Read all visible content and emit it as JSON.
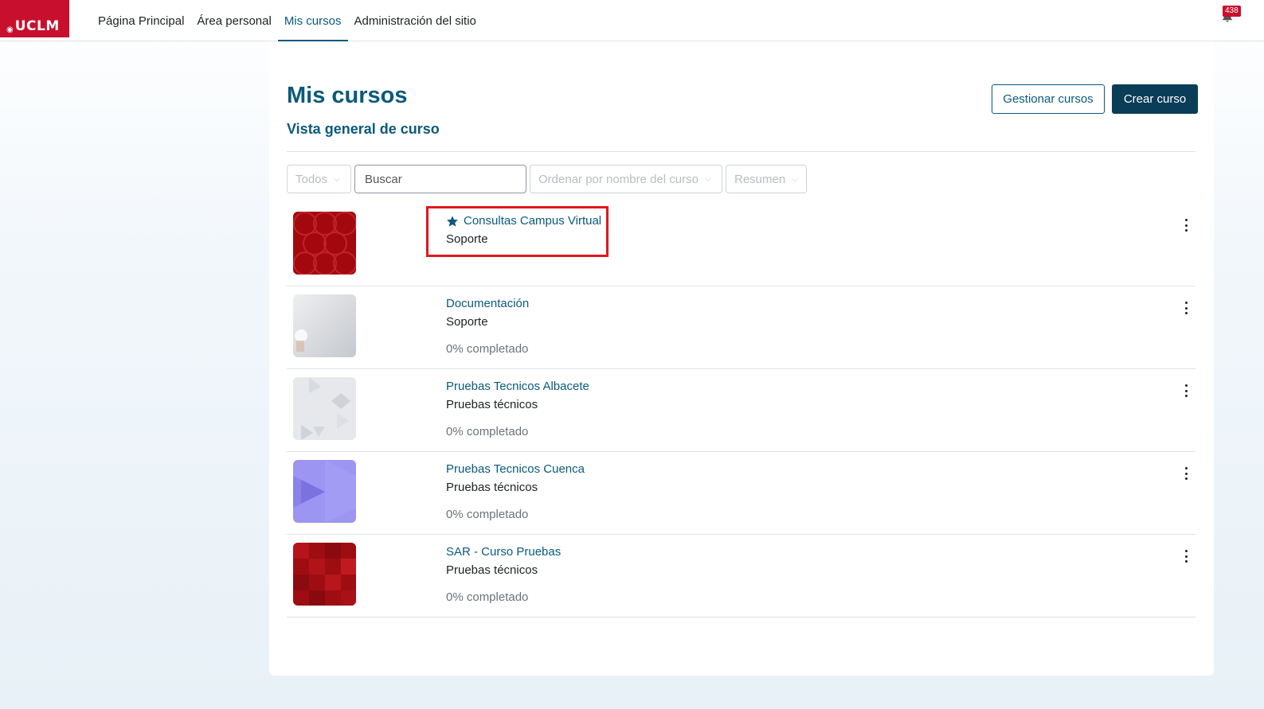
{
  "nav": {
    "logo": "UCLM",
    "items": [
      {
        "label": "Página Principal",
        "active": false
      },
      {
        "label": "Área personal",
        "active": false
      },
      {
        "label": "Mis cursos",
        "active": true
      },
      {
        "label": "Administración del sitio",
        "active": false
      }
    ],
    "notifications_count": "438"
  },
  "page": {
    "title": "Mis cursos",
    "manage_button": "Gestionar cursos",
    "create_button": "Crear curso",
    "section_title": "Vista general de curso"
  },
  "filters": {
    "grouping": "Todos",
    "search_placeholder": "Buscar",
    "sort": "Ordenar por nombre del curso",
    "view": "Resumen"
  },
  "courses": [
    {
      "name": "Consultas Campus Virtual",
      "category": "Soporte",
      "progress": "",
      "starred": true,
      "thumb": "red-circles"
    },
    {
      "name": "Documentación",
      "category": "Soporte",
      "progress": "0% completado",
      "starred": false,
      "thumb": "grey-bulb"
    },
    {
      "name": "Pruebas Tecnicos Albacete",
      "category": "Pruebas técnicos",
      "progress": "0% completado",
      "starred": false,
      "thumb": "light-triangles"
    },
    {
      "name": "Pruebas Tecnicos Cuenca",
      "category": "Pruebas técnicos",
      "progress": "0% completado",
      "starred": false,
      "thumb": "purple-triangles"
    },
    {
      "name": "SAR - Curso Pruebas",
      "category": "Pruebas técnicos",
      "progress": "0% completado",
      "starred": false,
      "thumb": "red-pixels"
    }
  ],
  "colors": {
    "brand_red": "#c8102e",
    "primary": "#0a5a7c",
    "primary_dark": "#0a3d57",
    "highlight": "#e0191f"
  }
}
